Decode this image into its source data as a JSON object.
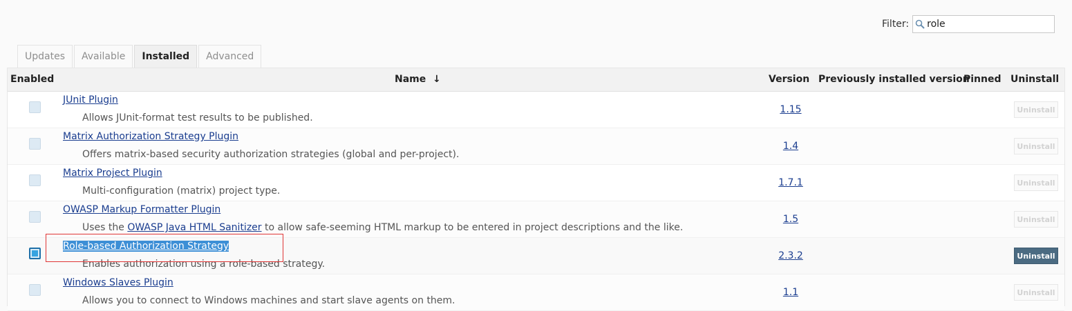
{
  "filter": {
    "label": "Filter:",
    "value": "role"
  },
  "tabs": [
    "Updates",
    "Available",
    "Installed",
    "Advanced"
  ],
  "active_tab": "Installed",
  "table": {
    "headers": {
      "enabled": "Enabled",
      "name": "Name",
      "sort": "↓",
      "version": "Version",
      "previous": "Previously installed version",
      "pinned": "Pinned",
      "uninstall": "Uninstall"
    },
    "rows": [
      {
        "name": "JUnit Plugin",
        "description": "Allows JUnit-format test results to be published.",
        "version": "1.15",
        "button": "Uninstall",
        "checked": false,
        "uninstall_enabled": false
      },
      {
        "name": "Matrix Authorization Strategy Plugin",
        "description": "Offers matrix-based security authorization strategies (global and per-project).",
        "version": "1.4",
        "button": "Uninstall",
        "checked": false,
        "uninstall_enabled": false
      },
      {
        "name": "Matrix Project Plugin",
        "description": "Multi-configuration (matrix) project type.",
        "version": "1.7.1",
        "button": "Uninstall",
        "checked": false,
        "uninstall_enabled": false
      },
      {
        "name": "OWASP Markup Formatter Plugin",
        "description_pre": "Uses the ",
        "description_link": "OWASP Java HTML Sanitizer",
        "description_post": " to allow safe-seeming HTML markup to be entered in project descriptions and the like.",
        "version": "1.5",
        "button": "Uninstall",
        "checked": false,
        "uninstall_enabled": false
      },
      {
        "name": "Role-based Authorization Strategy",
        "description": "Enables authorization using a role-based strategy.",
        "version": "2.3.2",
        "button": "Uninstall",
        "checked": true,
        "uninstall_enabled": true
      },
      {
        "name": "Windows Slaves Plugin",
        "description": "Allows you to connect to Windows machines and start slave agents on them.",
        "version": "1.1",
        "button": "Uninstall",
        "checked": false,
        "uninstall_enabled": false
      }
    ]
  },
  "colors": {
    "link": "#1a3d8f",
    "highlight": "#3d8fd6",
    "uninstall_active": "#4b6b82",
    "annotation_box": "#e03535"
  }
}
